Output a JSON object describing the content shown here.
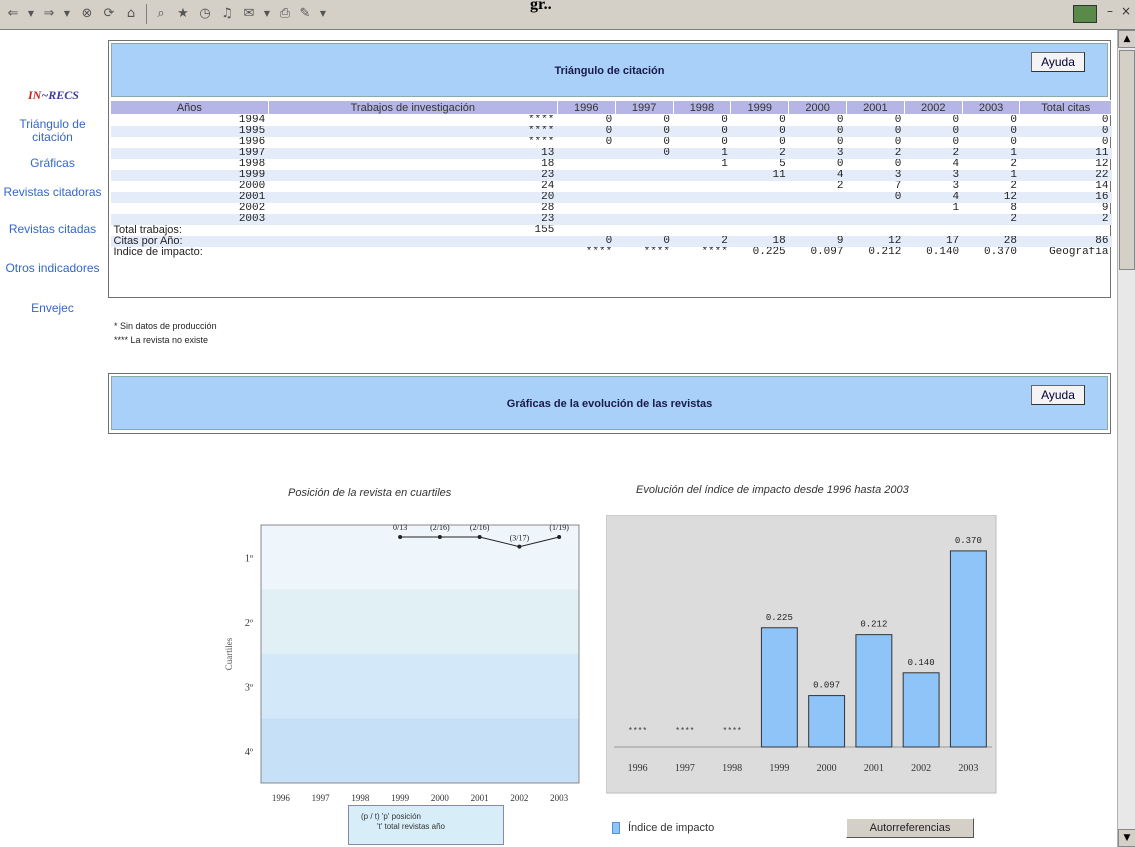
{
  "window": {
    "title": "gr.."
  },
  "toolbar": {
    "icons": [
      "back-icon",
      "forward-icon",
      "stop-icon",
      "refresh-icon",
      "home-icon",
      "search-icon",
      "favorites-icon",
      "history-icon",
      "mail-icon",
      "print-icon",
      "edit-icon"
    ]
  },
  "sidebar": {
    "logo_prefix": "IN",
    "logo_suffix": "RECS",
    "items": [
      {
        "label": "Triángulo de citación"
      },
      {
        "label": "Gráficas"
      },
      {
        "label": "Revistas citadoras"
      },
      {
        "label": "Revistas citadas"
      },
      {
        "label": "Otros indicadores"
      },
      {
        "label": "Envejec"
      }
    ]
  },
  "citation_panel": {
    "title": "Triángulo de citación",
    "help_label": "Ayuda",
    "columns": [
      "Años",
      "Trabajos de investigación",
      "1996",
      "1997",
      "1998",
      "1999",
      "2000",
      "2001",
      "2002",
      "2003",
      "Total citas"
    ],
    "rows": [
      [
        "1994",
        "****",
        "0",
        "0",
        "0",
        "0",
        "0",
        "0",
        "0",
        "0",
        "0"
      ],
      [
        "1995",
        "****",
        "0",
        "0",
        "0",
        "0",
        "0",
        "0",
        "0",
        "0",
        "0"
      ],
      [
        "1996",
        "****",
        "0",
        "0",
        "0",
        "0",
        "0",
        "0",
        "0",
        "0",
        "0"
      ],
      [
        "1997",
        "13",
        "",
        "0",
        "1",
        "2",
        "3",
        "2",
        "2",
        "1",
        "11"
      ],
      [
        "1998",
        "18",
        "",
        "",
        "1",
        "5",
        "0",
        "0",
        "4",
        "2",
        "12"
      ],
      [
        "1999",
        "23",
        "",
        "",
        "",
        "11",
        "4",
        "3",
        "3",
        "1",
        "22"
      ],
      [
        "2000",
        "24",
        "",
        "",
        "",
        "",
        "2",
        "7",
        "3",
        "2",
        "14"
      ],
      [
        "2001",
        "20",
        "",
        "",
        "",
        "",
        "",
        "0",
        "4",
        "12",
        "16"
      ],
      [
        "2002",
        "28",
        "",
        "",
        "",
        "",
        "",
        "",
        "1",
        "8",
        "9"
      ],
      [
        "2003",
        "23",
        "",
        "",
        "",
        "",
        "",
        "",
        "",
        "2",
        "2"
      ]
    ],
    "total_works_label": "Total trabajos:",
    "total_works_value": "155",
    "cites_per_year_label": "Citas por Año:",
    "cites_per_year": [
      "0",
      "0",
      "2",
      "18",
      "9",
      "12",
      "17",
      "28",
      "86"
    ],
    "impact_label": "Índice de impacto:",
    "impact_values": [
      "****",
      "****",
      "****",
      "0.225",
      "0.097",
      "0.212",
      "0.140",
      "0.370",
      "Geografía"
    ],
    "note1": "*      Sin datos de producción",
    "note2": "**** La revista no existe"
  },
  "graphs_panel": {
    "title": "Gráficas de la evolución de las revistas",
    "help_label": "Ayuda"
  },
  "chart_data": [
    {
      "type": "line",
      "title": "Posición de la revista en cuartiles",
      "xlabel": "",
      "ylabel": "Cuartiles",
      "x": [
        "1996",
        "1997",
        "1998",
        "1999",
        "2000",
        "2001",
        "2002",
        "2003"
      ],
      "y_categories": [
        "1º",
        "2º",
        "3º",
        "4º"
      ],
      "points": [
        {
          "x": "1999",
          "position": 0,
          "label": "0/13"
        },
        {
          "x": "2000",
          "position": 0,
          "label": "(2/16)"
        },
        {
          "x": "2001",
          "position": 0,
          "label": "(2/16)"
        },
        {
          "x": "2002",
          "position": 0.3,
          "label": "(3/17)"
        },
        {
          "x": "2003",
          "position": 0,
          "label": "(1/19)"
        }
      ],
      "quartile_colors": [
        "#eef6fb",
        "#e1f0f4",
        "#d3e8f8",
        "#c6e0f7"
      ],
      "legend": {
        "line1": "(p / t)   'p' posición",
        "line2": "'t' total revistas año"
      }
    },
    {
      "type": "bar",
      "title": "Evolución del índice de impacto desde 1996 hasta 2003",
      "categories": [
        "1996",
        "1997",
        "1998",
        "1999",
        "2000",
        "2001",
        "2002",
        "2003"
      ],
      "values": [
        null,
        null,
        null,
        0.225,
        0.097,
        0.212,
        0.14,
        0.37
      ],
      "labels": [
        "****",
        "****",
        "****",
        "0.225",
        "0.097",
        "0.212",
        "0.140",
        "0.370"
      ],
      "ylim": [
        0,
        0.4
      ],
      "series": [
        {
          "name": "Índice de impacto",
          "color": "#8ec4f8"
        }
      ],
      "autorref_label": "Autorreferencias"
    }
  ]
}
